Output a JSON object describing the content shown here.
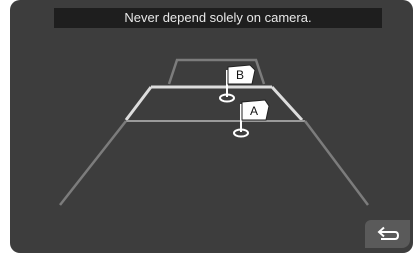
{
  "camera_view": {
    "warning_text": "Never depend solely on camera.",
    "markers": [
      {
        "label": "B"
      },
      {
        "label": "A"
      }
    ]
  },
  "controls": {
    "back_icon": "return-arrow-icon"
  },
  "colors": {
    "background": "#3d3d3d",
    "banner": "#1e1e1e",
    "guide_outer": "#7c7c7c",
    "guide_middle": "#dddddd",
    "guide_near": "#a9a9a9"
  }
}
